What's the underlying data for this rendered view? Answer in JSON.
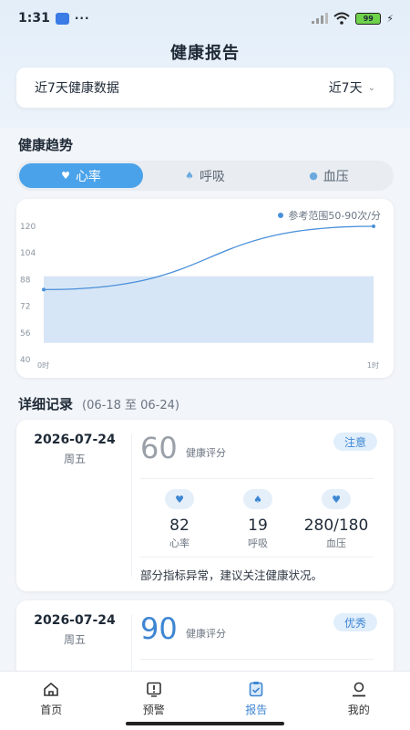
{
  "status_bar": {
    "time": "1:31",
    "more": "···",
    "battery": "99"
  },
  "header": {
    "title": "健康报告"
  },
  "period": {
    "label": "近7天健康数据",
    "selected": "近7天"
  },
  "trend": {
    "title": "健康趋势",
    "tabs": [
      {
        "label": "心率",
        "icon": "heart-icon",
        "active": true
      },
      {
        "label": "呼吸",
        "icon": "lungs-icon",
        "active": false
      },
      {
        "label": "血压",
        "icon": "blood-drop-icon",
        "active": false
      }
    ]
  },
  "chart_data": {
    "type": "line",
    "legend": "参考范围50-90次/分",
    "y_ticks": [
      40,
      56,
      72,
      88,
      104,
      120
    ],
    "x_ticks": [
      "0时",
      "1时"
    ],
    "ylim": [
      40,
      120
    ],
    "reference_range": [
      50,
      90
    ],
    "series": [
      {
        "x": [
          0,
          1
        ],
        "values": [
          82,
          120
        ]
      }
    ],
    "colors": {
      "line": "#4a90d9",
      "band": "#d7e6f6"
    }
  },
  "detail": {
    "title": "详细记录",
    "range": "(06-18 至 06-24)"
  },
  "records": [
    {
      "date": "2026-07-24",
      "weekday": "周五",
      "score": "60",
      "score_color": "#9aa0a8",
      "score_label": "健康评分",
      "badge": "注意",
      "metrics": [
        {
          "value": "82",
          "label": "心率",
          "icon": "heart-icon"
        },
        {
          "value": "19",
          "label": "呼吸",
          "icon": "lungs-icon"
        },
        {
          "value": "280/180",
          "label": "血压",
          "icon": "heart-icon"
        }
      ],
      "note": "部分指标异常，建议关注健康状况。"
    },
    {
      "date": "2026-07-24",
      "weekday": "周五",
      "score": "90",
      "score_color": "#3d86d3",
      "score_label": "健康评分",
      "badge": "优秀"
    }
  ],
  "nav": [
    {
      "label": "首页",
      "icon": "home-icon",
      "active": false
    },
    {
      "label": "预警",
      "icon": "alert-icon",
      "active": false
    },
    {
      "label": "报告",
      "icon": "report-icon",
      "active": true
    },
    {
      "label": "我的",
      "icon": "profile-icon",
      "active": false
    }
  ]
}
